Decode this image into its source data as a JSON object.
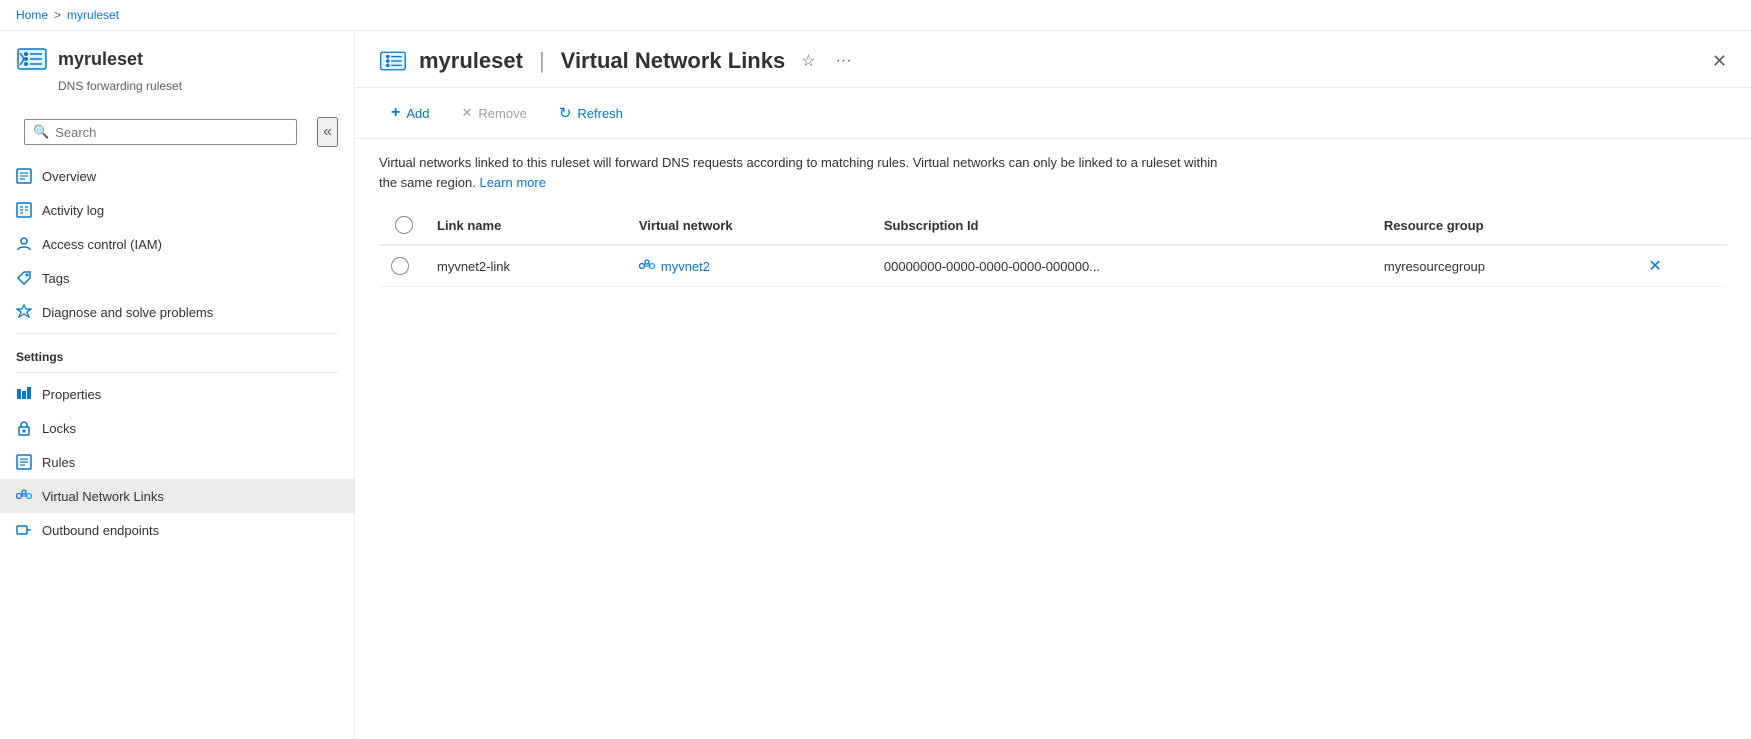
{
  "breadcrumb": {
    "home": "Home",
    "separator": ">",
    "current": "myruleset"
  },
  "resource": {
    "name": "myruleset",
    "separator": "|",
    "page": "Virtual Network Links",
    "subtitle": "DNS forwarding ruleset"
  },
  "toolbar": {
    "add_label": "Add",
    "remove_label": "Remove",
    "refresh_label": "Refresh"
  },
  "description": {
    "text": "Virtual networks linked to this ruleset will forward DNS requests according to matching rules. Virtual networks can only be linked to a ruleset within the same region.",
    "link_text": "Learn more"
  },
  "table": {
    "columns": [
      "Link name",
      "Virtual network",
      "Subscription Id",
      "Resource group"
    ],
    "rows": [
      {
        "link_name": "myvnet2-link",
        "virtual_network": "myvnet2",
        "subscription_id": "00000000-0000-0000-0000-000000...",
        "resource_group": "myresourcegroup"
      }
    ]
  },
  "sidebar": {
    "search_placeholder": "Search",
    "nav_items": [
      {
        "id": "overview",
        "label": "Overview",
        "icon": "document-icon"
      },
      {
        "id": "activity-log",
        "label": "Activity log",
        "icon": "list-icon"
      },
      {
        "id": "access-control",
        "label": "Access control (IAM)",
        "icon": "person-icon"
      },
      {
        "id": "tags",
        "label": "Tags",
        "icon": "tag-icon"
      },
      {
        "id": "diagnose",
        "label": "Diagnose and solve problems",
        "icon": "wrench-icon"
      }
    ],
    "settings_label": "Settings",
    "settings_items": [
      {
        "id": "properties",
        "label": "Properties",
        "icon": "bars-icon"
      },
      {
        "id": "locks",
        "label": "Locks",
        "icon": "lock-icon"
      },
      {
        "id": "rules",
        "label": "Rules",
        "icon": "document-icon"
      },
      {
        "id": "virtual-network-links",
        "label": "Virtual Network Links",
        "icon": "dns-icon",
        "active": true
      },
      {
        "id": "outbound-endpoints",
        "label": "Outbound endpoints",
        "icon": "endpoint-icon"
      }
    ]
  },
  "icons": {
    "star": "☆",
    "more": "···",
    "close": "✕",
    "collapse": "«",
    "add": "+",
    "remove": "✕",
    "refresh": "↻",
    "delete_row": "✕"
  }
}
